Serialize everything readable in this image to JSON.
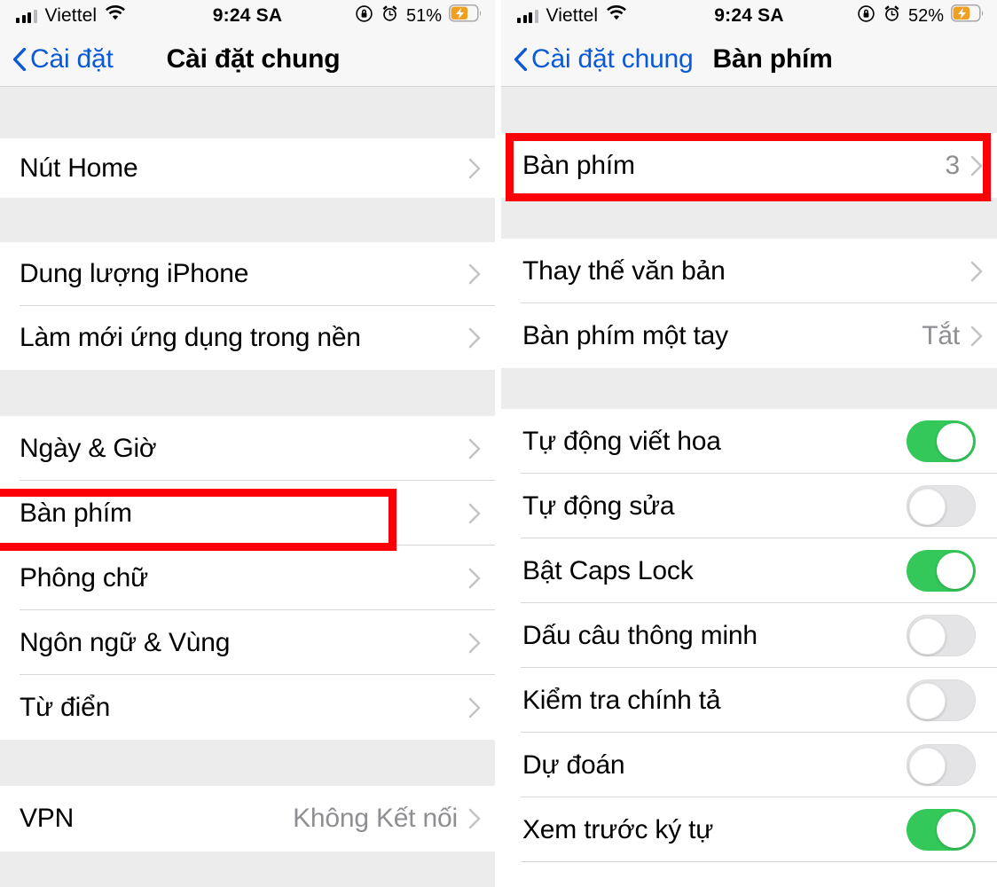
{
  "screens": [
    {
      "id": "general-settings",
      "status_bar": {
        "carrier": "Viettel",
        "signal_icon": "signal-bars-icon",
        "wifi_icon": "wifi-icon",
        "time": "9:24 SA",
        "rotation_lock_icon": "rotation-lock-icon",
        "alarm_icon": "alarm-clock-icon",
        "battery_percent": "51%",
        "battery_icon": "battery-charging-icon"
      },
      "nav": {
        "back_label": "Cài đặt",
        "back_icon": "chevron-left-icon",
        "title": "Cài đặt chung"
      },
      "sections": [
        {
          "rows": [
            {
              "label": "Nút Home",
              "value": "",
              "accessory": "chevron-right-icon",
              "highlighted": false
            }
          ]
        },
        {
          "rows": [
            {
              "label": "Dung lượng iPhone",
              "value": "",
              "accessory": "chevron-right-icon",
              "highlighted": false
            },
            {
              "label": "Làm mới ứng dụng trong nền",
              "value": "",
              "accessory": "chevron-right-icon",
              "highlighted": false
            }
          ]
        },
        {
          "rows": [
            {
              "label": "Ngày & Giờ",
              "value": "",
              "accessory": "chevron-right-icon",
              "highlighted": false
            },
            {
              "label": "Bàn phím",
              "value": "",
              "accessory": "chevron-right-icon",
              "highlighted": true
            },
            {
              "label": "Phông chữ",
              "value": "",
              "accessory": "chevron-right-icon",
              "highlighted": false
            },
            {
              "label": "Ngôn ngữ & Vùng",
              "value": "",
              "accessory": "chevron-right-icon",
              "highlighted": false
            },
            {
              "label": "Từ điển",
              "value": "",
              "accessory": "chevron-right-icon",
              "highlighted": false
            }
          ]
        },
        {
          "rows": [
            {
              "label": "VPN",
              "value": "Không Kết nối",
              "accessory": "chevron-right-icon",
              "highlighted": false
            }
          ]
        }
      ]
    },
    {
      "id": "keyboard-settings",
      "status_bar": {
        "carrier": "Viettel",
        "signal_icon": "signal-bars-icon",
        "wifi_icon": "wifi-icon",
        "time": "9:24 SA",
        "rotation_lock_icon": "rotation-lock-icon",
        "alarm_icon": "alarm-clock-icon",
        "battery_percent": "52%",
        "battery_icon": "battery-charging-icon"
      },
      "nav": {
        "back_label": "Cài đặt chung",
        "back_icon": "chevron-left-icon",
        "title": "Bàn phím"
      },
      "sections": [
        {
          "rows": [
            {
              "label": "Bàn phím",
              "value": "3",
              "accessory": "chevron-right-icon",
              "highlighted": true
            }
          ]
        },
        {
          "rows": [
            {
              "label": "Thay thế văn bản",
              "value": "",
              "accessory": "chevron-right-icon",
              "highlighted": false
            },
            {
              "label": "Bàn phím một tay",
              "value": "Tắt",
              "accessory": "chevron-right-icon",
              "highlighted": false
            }
          ]
        },
        {
          "rows": [
            {
              "label": "Tự động viết hoa",
              "accessory": "toggle",
              "toggle_on": true
            },
            {
              "label": "Tự động sửa",
              "accessory": "toggle",
              "toggle_on": false
            },
            {
              "label": "Bật Caps Lock",
              "accessory": "toggle",
              "toggle_on": true
            },
            {
              "label": "Dấu câu thông minh",
              "accessory": "toggle",
              "toggle_on": false
            },
            {
              "label": "Kiểm tra chính tả",
              "accessory": "toggle",
              "toggle_on": false
            },
            {
              "label": "Dự đoán",
              "accessory": "toggle",
              "toggle_on": false
            },
            {
              "label": "Xem trước ký tự",
              "accessory": "toggle",
              "toggle_on": true
            }
          ]
        }
      ]
    }
  ],
  "colors": {
    "accent_blue": "#0b59d6",
    "toggle_on_green": "#34c759",
    "highlight_red": "#fb0007",
    "group_background": "#ececed",
    "secondary_text": "#8e8e93"
  }
}
